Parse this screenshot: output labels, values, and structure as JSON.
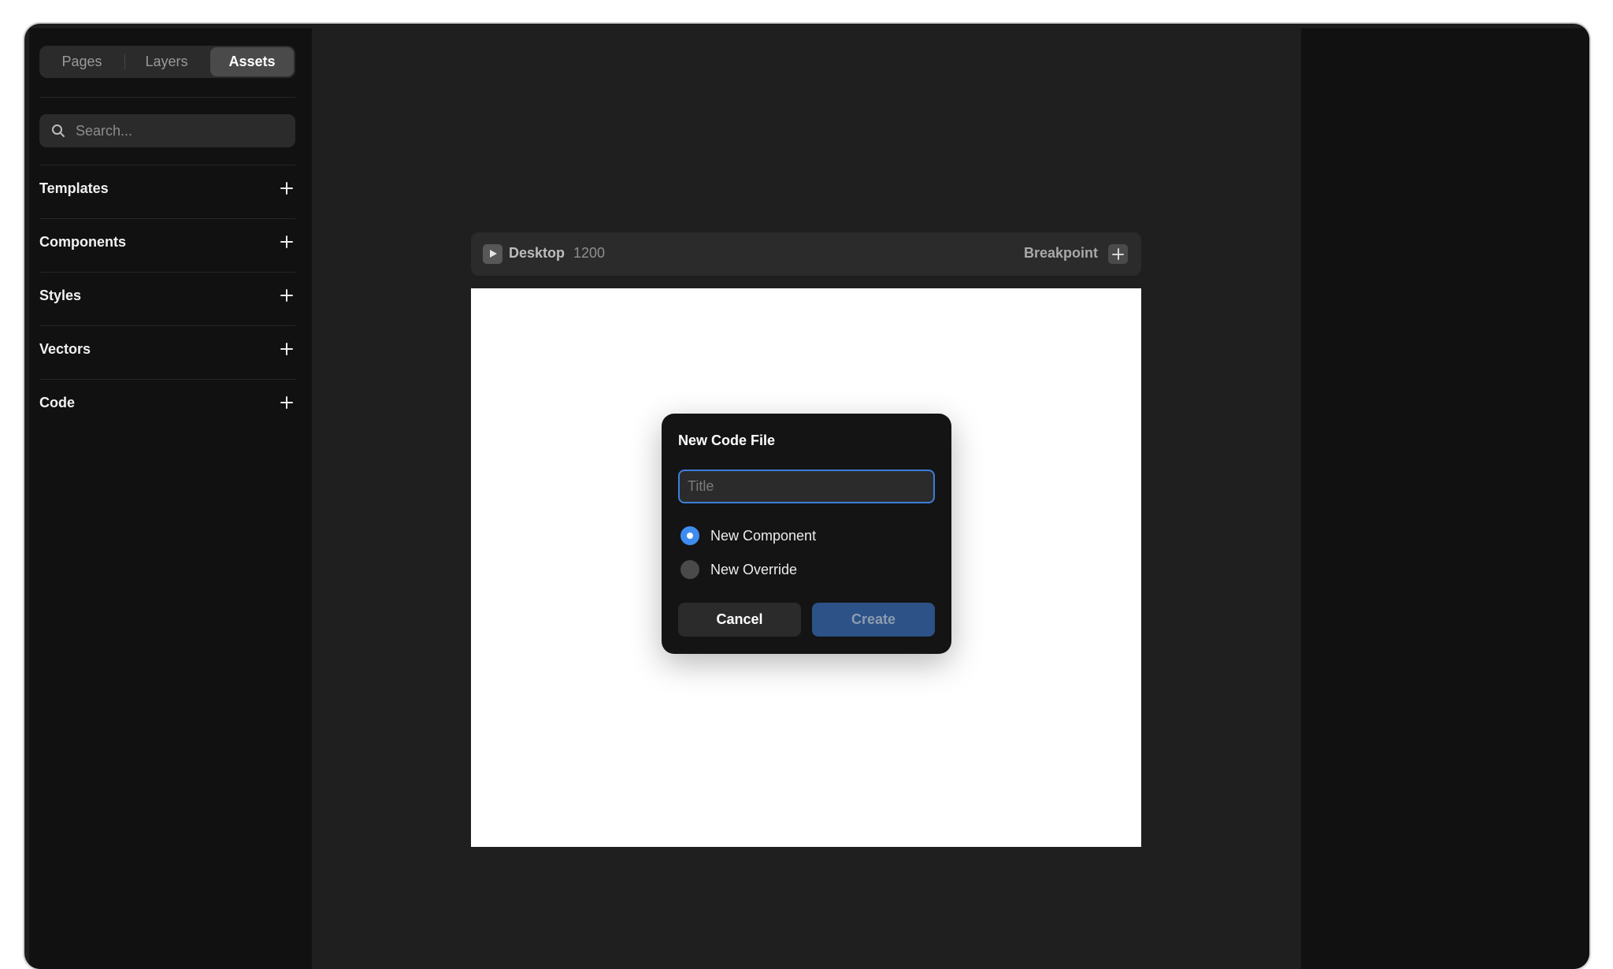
{
  "sidebar": {
    "tabs": [
      {
        "label": "Pages"
      },
      {
        "label": "Layers"
      },
      {
        "label": "Assets"
      }
    ],
    "search": {
      "placeholder": "Search...",
      "value": ""
    },
    "sections": [
      {
        "label": "Templates"
      },
      {
        "label": "Components"
      },
      {
        "label": "Styles"
      },
      {
        "label": "Vectors"
      },
      {
        "label": "Code"
      }
    ]
  },
  "frame": {
    "name": "Desktop",
    "width": "1200",
    "breakpoint_label": "Breakpoint"
  },
  "dialog": {
    "title": "New Code File",
    "input": {
      "placeholder": "Title",
      "value": ""
    },
    "options": [
      {
        "label": "New Component",
        "selected": true
      },
      {
        "label": "New Override",
        "selected": false
      }
    ],
    "cancel_label": "Cancel",
    "create_label": "Create"
  },
  "colors": {
    "accent": "#3f8cf0",
    "create_button": "#2c5287",
    "panel_bg": "#111111",
    "canvas_bg": "#1f1f1f"
  }
}
